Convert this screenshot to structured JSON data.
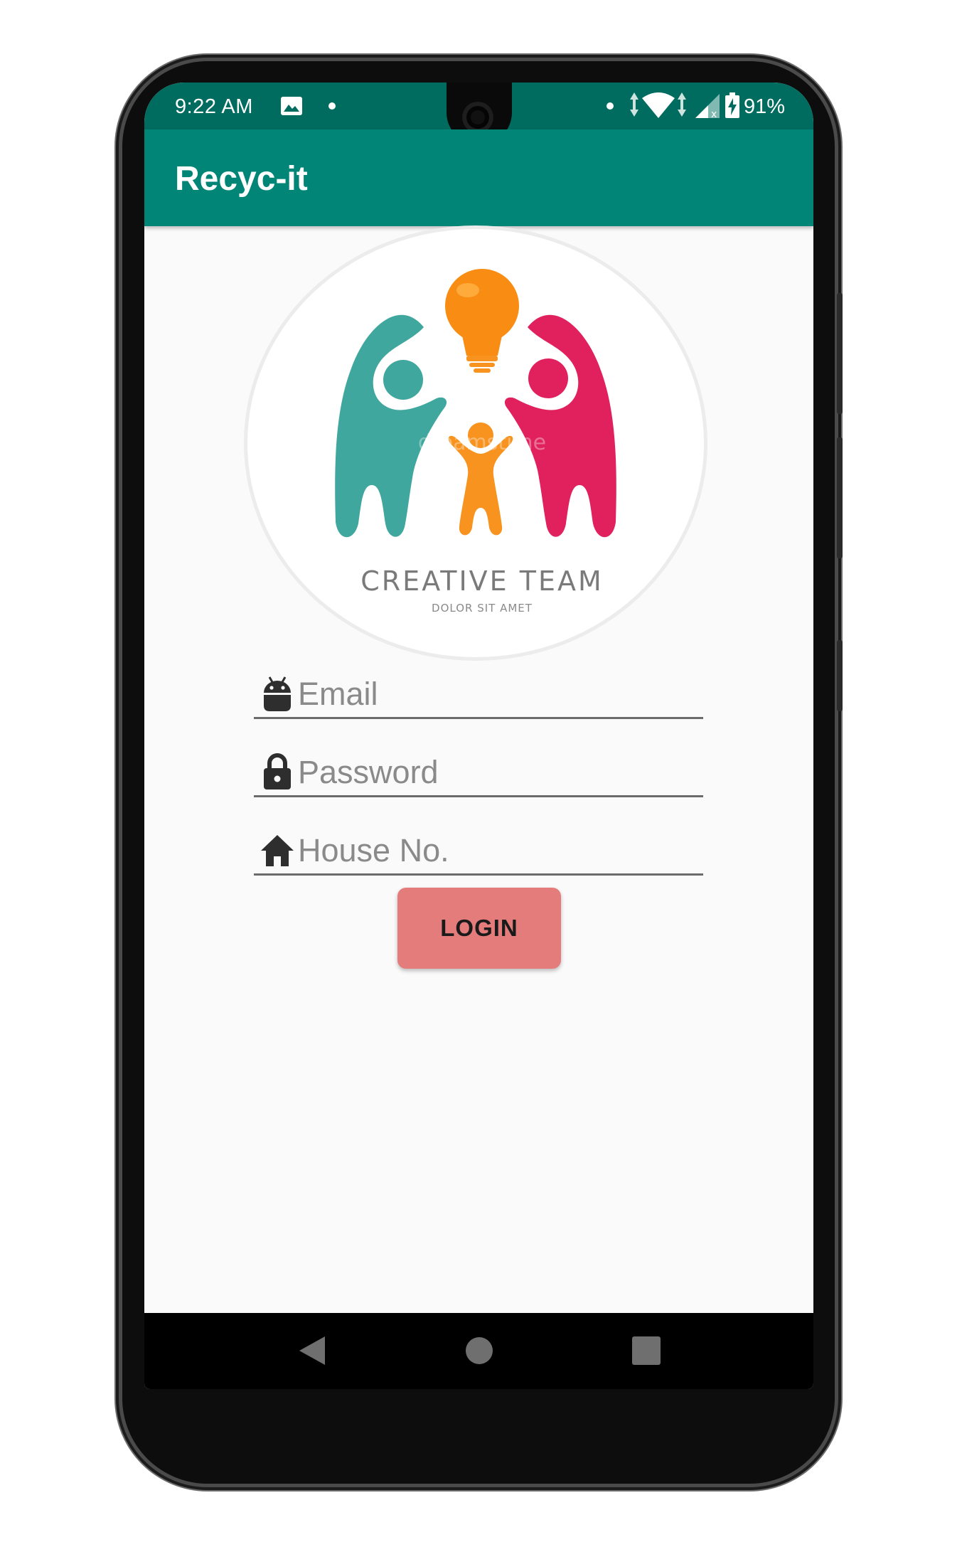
{
  "statusbar": {
    "time": "9:22 AM",
    "battery": "91%",
    "icons": [
      "image-icon",
      "notification-dot-icon",
      "data-arrows-icon",
      "wifi-icon",
      "signal-icon",
      "battery-charging-icon"
    ]
  },
  "appbar": {
    "title": "Recyc-it"
  },
  "logo": {
    "title": "CREATIVE TEAM",
    "subtitle": "DOLOR SIT AMET",
    "watermark": "dreamstime",
    "colors": {
      "teal": "#3fa79d",
      "pink": "#e0215d",
      "orange": "#f7931e",
      "bulb": "#f98c12"
    }
  },
  "form": {
    "email": {
      "placeholder": "Email",
      "value": "",
      "icon": "android-icon"
    },
    "password": {
      "placeholder": "Password",
      "value": "",
      "icon": "lock-icon"
    },
    "house": {
      "placeholder": "House No.",
      "value": "",
      "icon": "home-icon"
    },
    "login_label": "LOGIN"
  },
  "navbar": {
    "icons": [
      "back-icon",
      "home-nav-icon",
      "recents-icon"
    ]
  },
  "theme": {
    "primary": "#008577",
    "primary_dark": "#006b5f",
    "button": "#e57c7c"
  }
}
